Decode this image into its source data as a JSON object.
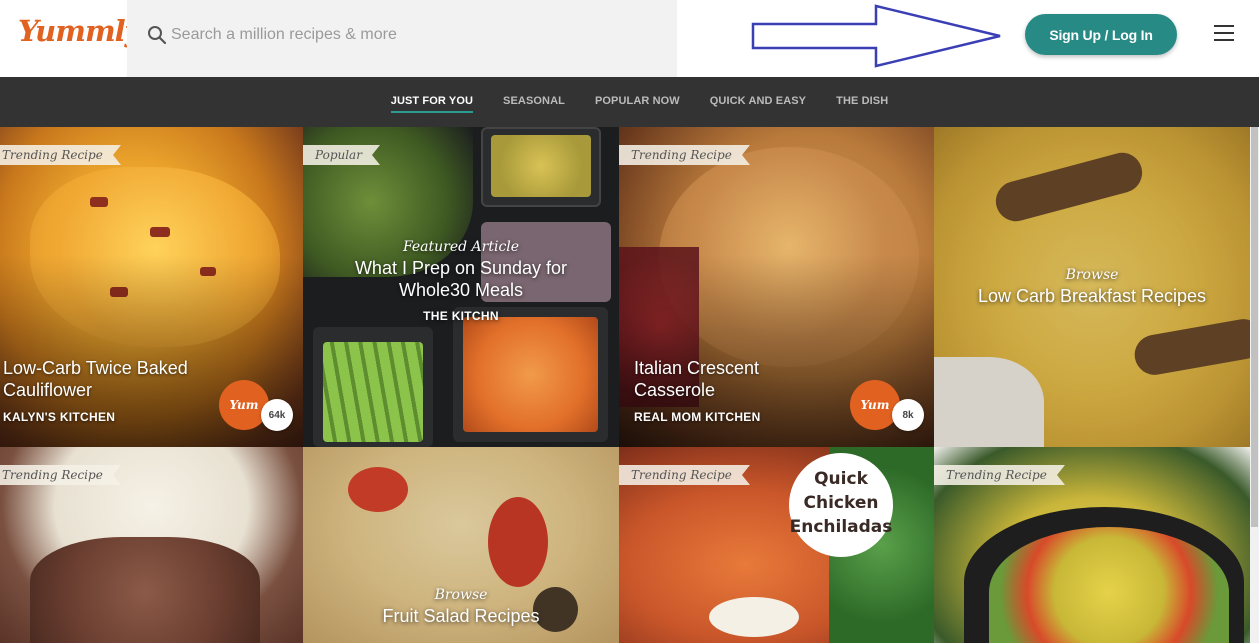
{
  "header": {
    "logo": "Yummly",
    "search_placeholder": "Search a million recipes & more",
    "signup_label": "Sign Up / Log In"
  },
  "nav": {
    "tabs": [
      {
        "label": "JUST FOR YOU",
        "active": true
      },
      {
        "label": "SEASONAL",
        "active": false
      },
      {
        "label": "POPULAR NOW",
        "active": false
      },
      {
        "label": "QUICK AND EASY",
        "active": false
      },
      {
        "label": "THE DISH",
        "active": false
      }
    ]
  },
  "tiles": {
    "t1": {
      "tag": "Trending Recipe",
      "title": "Low-Carb Twice Baked Cauliflower",
      "source": "KALYN'S KITCHEN",
      "yum": "Yum",
      "count": "64k"
    },
    "t2": {
      "tag": "Popular",
      "kicker": "Featured Article",
      "title": "What I Prep on Sunday for Whole30 Meals",
      "source": "THE KITCHN"
    },
    "t3": {
      "tag": "Trending Recipe",
      "title": "Italian Crescent Casserole",
      "source": "REAL MOM KITCHEN",
      "yum": "Yum",
      "count": "8k"
    },
    "t4": {
      "kicker": "Browse",
      "title": "Low Carb Breakfast Recipes"
    },
    "t5": {
      "tag": "Trending Recipe"
    },
    "t6": {
      "kicker": "Browse",
      "title": "Fruit Salad Recipes"
    },
    "t7": {
      "tag": "Trending Recipe",
      "badge_line1": "Quick",
      "badge_line2": "Chicken",
      "badge_line3": "Enchiladas"
    },
    "t8": {
      "tag": "Trending Recipe"
    }
  },
  "colors": {
    "brand": "#e16120",
    "accent": "#278a84",
    "nav_bg": "#333333"
  },
  "icons": {
    "search": "search-icon",
    "menu": "hamburger-menu-icon",
    "annotation": "arrow-annotation-icon"
  }
}
